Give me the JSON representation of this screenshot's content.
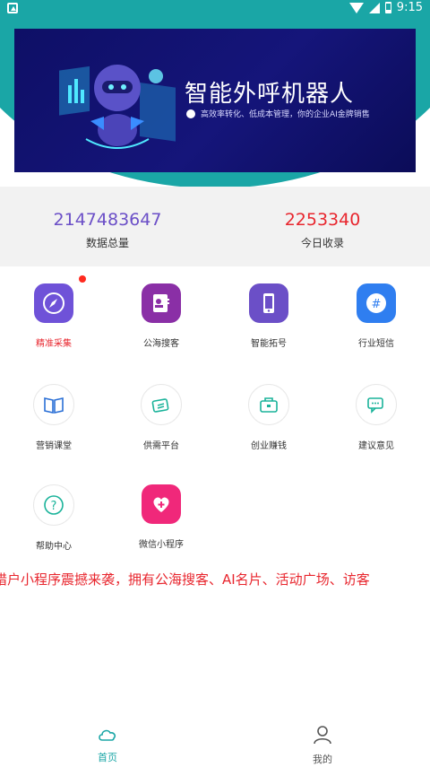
{
  "status_bar": {
    "time": "9:15"
  },
  "banner": {
    "title": "智能外呼机器人",
    "subtitle": "高效率转化、低成本管理，你的企业AI金牌销售"
  },
  "stats": [
    {
      "value": "2147483647",
      "label": "数据总量",
      "color": "#6b4fc7"
    },
    {
      "value": "2253340",
      "label": "今日收录",
      "color": "#e8262e"
    }
  ],
  "grid": [
    {
      "label": "精准采集",
      "icon": "compass-icon",
      "highlight": true,
      "badge": true
    },
    {
      "label": "公海搜客",
      "icon": "contact-card-icon"
    },
    {
      "label": "智能拓号",
      "icon": "mobile-phone-icon"
    },
    {
      "label": "行业短信",
      "icon": "hashtag-chat-icon"
    },
    {
      "label": "营销课堂",
      "icon": "open-book-icon"
    },
    {
      "label": "供需平台",
      "icon": "cards-icon"
    },
    {
      "label": "创业赚钱",
      "icon": "briefcase-icon"
    },
    {
      "label": "建议意见",
      "icon": "chat-bubbles-icon"
    },
    {
      "label": "帮助中心",
      "icon": "question-icon"
    },
    {
      "label": "微信小程序",
      "icon": "heart-plus-icon"
    }
  ],
  "marquee": "猎户小程序震撼来袭，拥有公海搜客、AI名片、活动广场、访客",
  "bottom_nav": [
    {
      "label": "首页",
      "icon": "cloud-icon",
      "active": true
    },
    {
      "label": "我的",
      "icon": "person-icon",
      "active": false
    }
  ],
  "colors": {
    "accent": "#1aa6a6",
    "banner_bg": "#0e0f66",
    "alert": "#e8262e"
  }
}
